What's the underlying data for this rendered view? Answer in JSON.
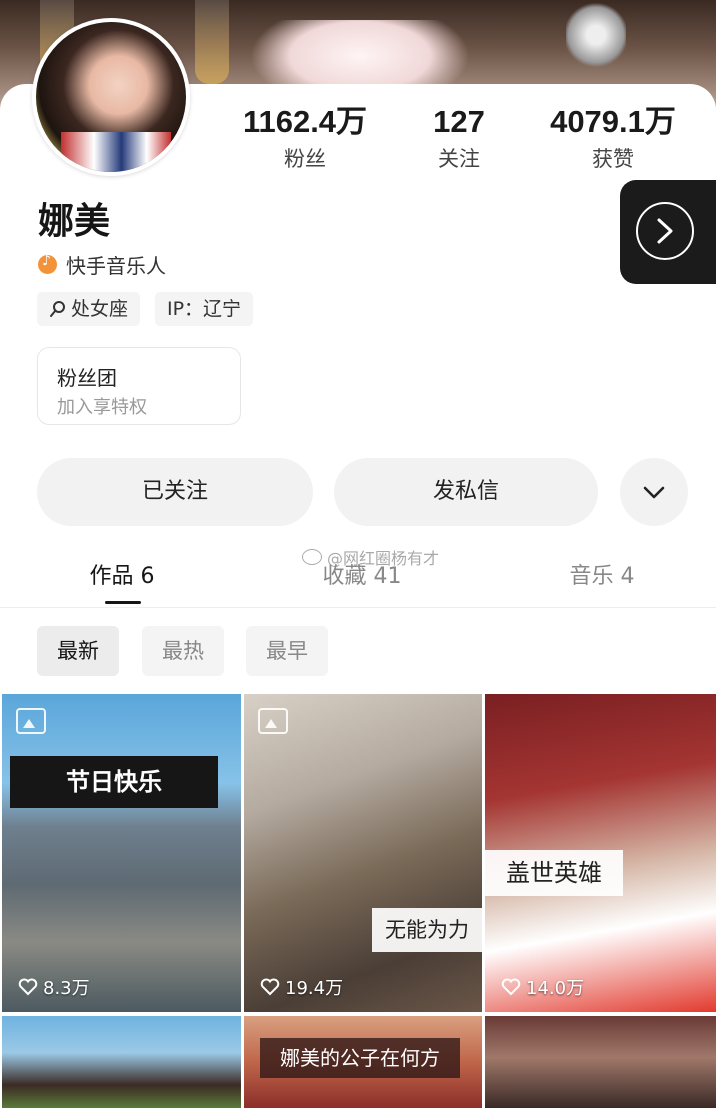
{
  "profile": {
    "name": "娜美",
    "role": "快手音乐人",
    "tags": [
      "处女座",
      "IP：辽宁"
    ]
  },
  "stats": [
    {
      "value": "1162.4万",
      "label": "粉丝"
    },
    {
      "value": "127",
      "label": "关注"
    },
    {
      "value": "4079.1万",
      "label": "获赞"
    }
  ],
  "fan_club": {
    "title": "粉丝团",
    "subtitle": "加入享特权"
  },
  "actions": {
    "follow_label": "已关注",
    "message_label": "发私信"
  },
  "tabs": [
    {
      "label": "作品 6",
      "active": true
    },
    {
      "label": "收藏 41",
      "active": false
    },
    {
      "label": "音乐 4",
      "active": false
    }
  ],
  "filters": [
    {
      "label": "最新",
      "active": true
    },
    {
      "label": "最热",
      "active": false
    },
    {
      "label": "最早",
      "active": false
    }
  ],
  "watermark": "@网红圈杨有才",
  "posts": [
    {
      "caption": "节日快乐",
      "likes": "8.3万"
    },
    {
      "caption": "无能为力",
      "likes": "19.4万"
    },
    {
      "caption": "盖世英雄",
      "likes": "14.0万"
    },
    {
      "caption": "",
      "likes": ""
    },
    {
      "caption": "娜美的公子在何方",
      "likes": ""
    },
    {
      "caption": "",
      "likes": ""
    }
  ],
  "colors": {
    "accent_orange": "#f2933a",
    "dark": "#1b1b1b",
    "pill_bg": "#f2f2f2"
  },
  "icons": [
    "chevron-right-icon",
    "chevron-down-icon",
    "music-note-icon",
    "search-tag-icon",
    "image-icon",
    "heart-icon"
  ]
}
